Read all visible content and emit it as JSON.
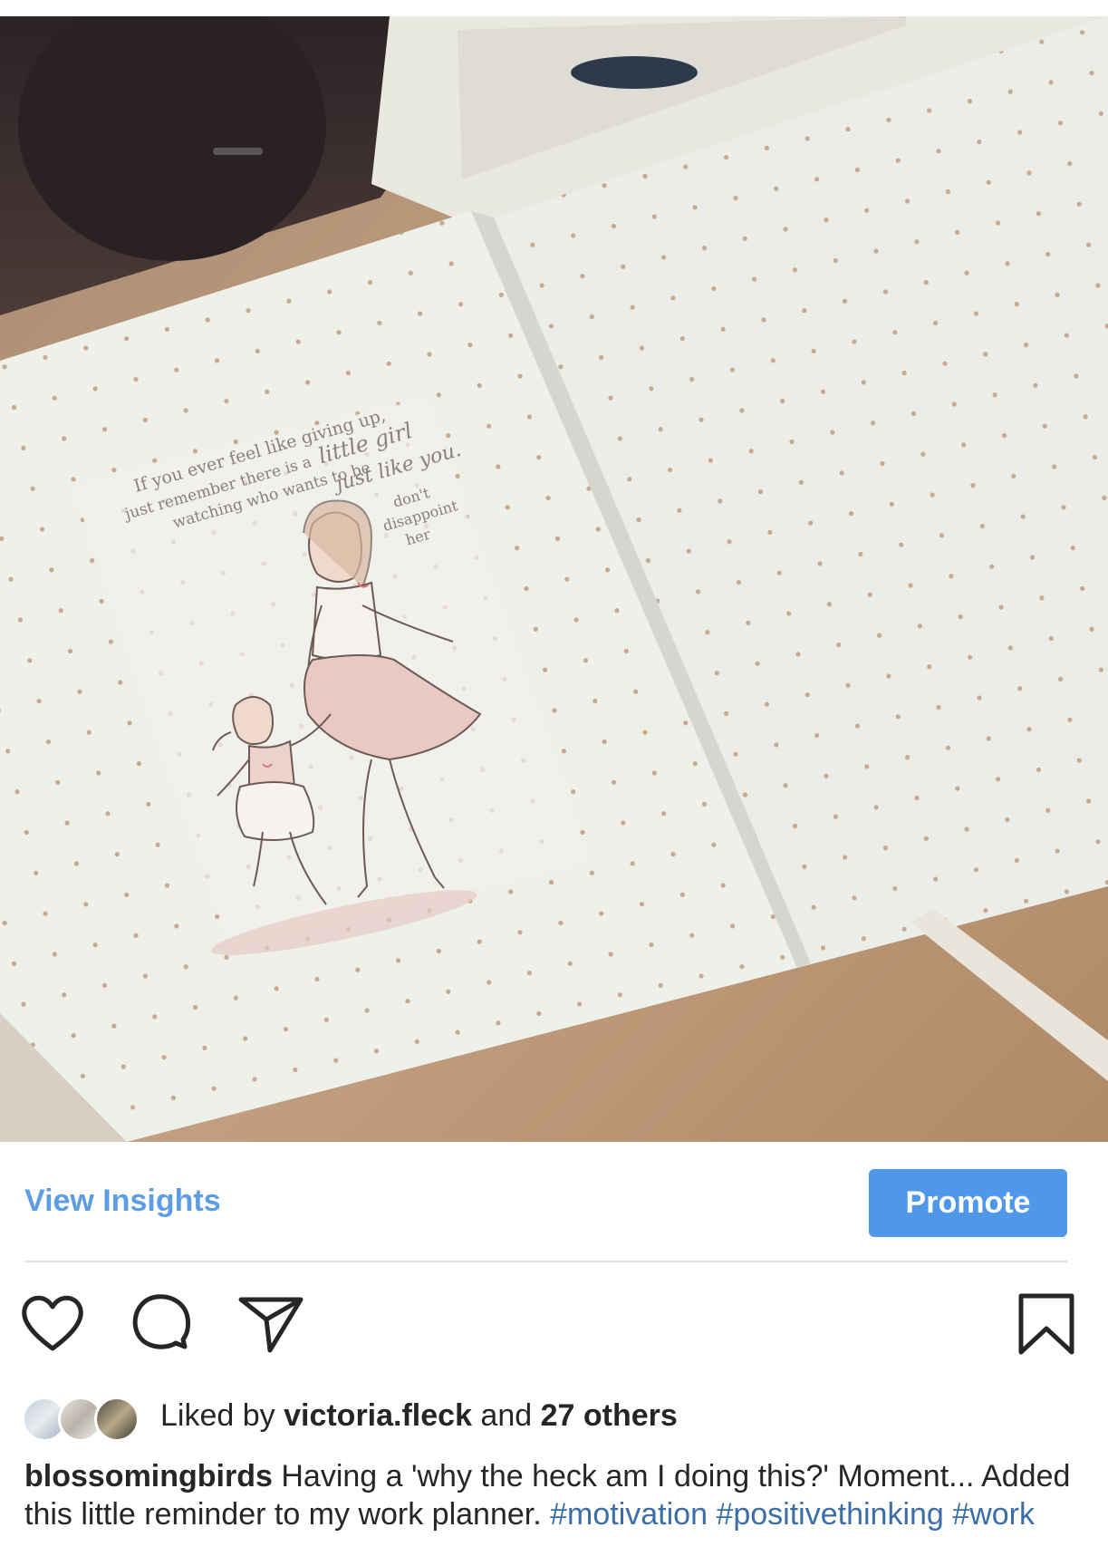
{
  "post": {
    "photo_text": {
      "line1": "If you ever feel like giving up,",
      "line2": "just remember there is a",
      "line2_script": "little girl",
      "line3": "watching who wants to be",
      "line4_script": "just like you.",
      "line5": "don't",
      "line6": "disappoint",
      "line7": "her"
    },
    "insights": {
      "view_label": "View Insights",
      "promote_label": "Promote"
    },
    "likes": {
      "prefix": "Liked by ",
      "user": "victoria.fleck",
      "middle": " and ",
      "others": "27 others"
    },
    "caption": {
      "username": "blossomingbirds",
      "text": " Having a 'why the heck am I doing this?' Moment... Added this little reminder to my work planner. ",
      "hashtags": [
        "#motivation",
        "#positivethinking",
        "#work"
      ]
    }
  },
  "icons": [
    "heart-icon",
    "comment-icon",
    "share-icon",
    "bookmark-icon"
  ],
  "colors": {
    "link_blue": "#5d9de4",
    "promote_blue": "#4f97e8",
    "hashtag_blue": "#3a6ea5",
    "text": "#262626"
  }
}
